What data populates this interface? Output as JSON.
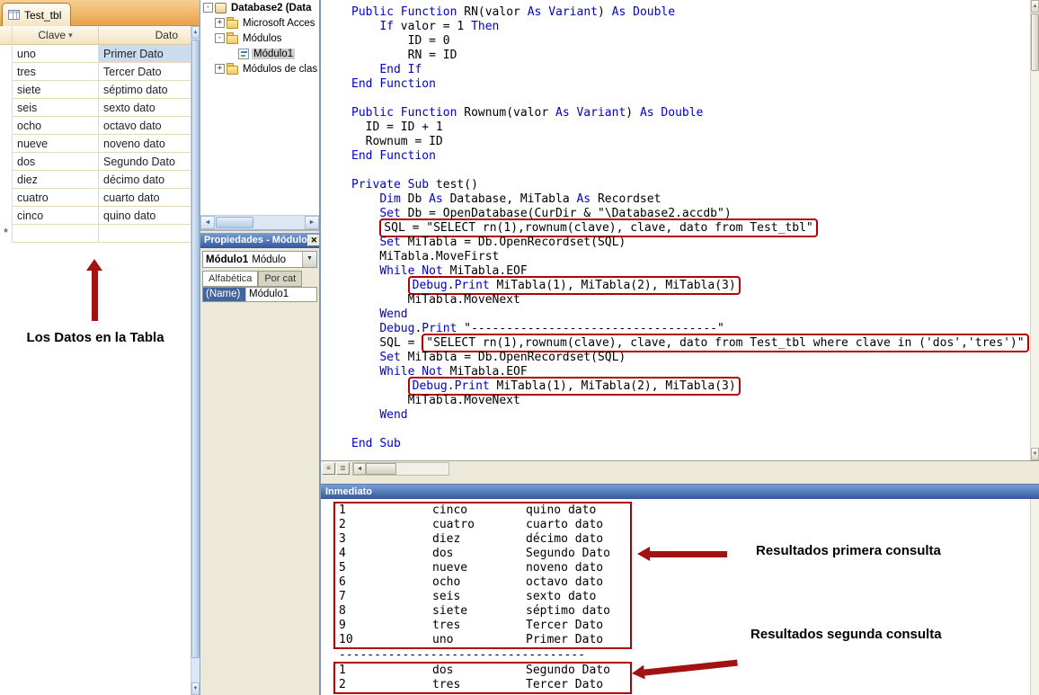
{
  "colors": {
    "annotation_red": "#a31212",
    "highlight_red": "#b40000",
    "keyword_blue": "#0000c8",
    "selection_blue": "#cbdcf0"
  },
  "table_panel": {
    "tab": "Test_tbl",
    "header": {
      "clave": "Clave",
      "dato": "Dato"
    },
    "rows": [
      {
        "clave": "uno",
        "dato": "Primer Dato",
        "selected": true
      },
      {
        "clave": "tres",
        "dato": "Tercer Dato"
      },
      {
        "clave": "siete",
        "dato": "séptimo dato"
      },
      {
        "clave": "seis",
        "dato": "sexto dato"
      },
      {
        "clave": "ocho",
        "dato": "octavo dato"
      },
      {
        "clave": "nueve",
        "dato": "noveno dato"
      },
      {
        "clave": "dos",
        "dato": "Segundo Dato"
      },
      {
        "clave": "diez",
        "dato": "décimo dato"
      },
      {
        "clave": "cuatro",
        "dato": "cuarto dato"
      },
      {
        "clave": "cinco",
        "dato": "quino dato"
      }
    ],
    "new_record_marker": "*",
    "annotation": "Los Datos en la Tabla"
  },
  "vbe": {
    "project_tree": {
      "items": [
        {
          "label": "Database2 (Data",
          "icon": "db",
          "expander": "-",
          "level": 0,
          "bold": true
        },
        {
          "label": "Microsoft Acces",
          "icon": "folder",
          "expander": "+",
          "level": 1
        },
        {
          "label": "Módulos",
          "icon": "folder",
          "expander": "-",
          "level": 1
        },
        {
          "label": "Módulo1",
          "icon": "module",
          "expander": "",
          "level": 2,
          "selected": true
        },
        {
          "label": "Módulos de clas",
          "icon": "folder",
          "expander": "+",
          "level": 1
        }
      ]
    },
    "properties": {
      "title": "Propiedades - Módulo",
      "close_glyph": "✕",
      "selector_name": "Módulo1",
      "selector_type": "Módulo",
      "tabs": [
        {
          "label": "Alfabética"
        },
        {
          "label": "Por cat"
        }
      ],
      "grid": {
        "name": "(Name)",
        "value": "Módulo1"
      }
    }
  },
  "code": {
    "keywords": [
      "Public",
      "Private",
      "Function",
      "Sub",
      "End",
      "If",
      "Then",
      "Dim",
      "Set",
      "As",
      "While",
      "Not",
      "Wend",
      "Debug",
      "Print",
      "Variant",
      "Double"
    ],
    "lines": [
      {
        "text": "Public Function RN(valor As Variant) As Double"
      },
      {
        "text": "    If valor = 1 Then"
      },
      {
        "text": "        ID = 0"
      },
      {
        "text": "        RN = ID"
      },
      {
        "text": "    End If"
      },
      {
        "text": "End Function"
      },
      {
        "text": ""
      },
      {
        "text": "Public Function Rownum(valor As Variant) As Double"
      },
      {
        "text": "  ID = ID + 1"
      },
      {
        "text": "  Rownum = ID"
      },
      {
        "text": "End Function"
      },
      {
        "text": ""
      },
      {
        "text": "Private Sub test()"
      },
      {
        "text": "    Dim Db As Database, MiTabla As Recordset"
      },
      {
        "text": "    Set Db = OpenDatabase(CurDir & \"\\Database2.accdb\")"
      },
      {
        "text": "    SQL = \"SELECT rn(1),rownum(clave), clave, dato from Test_tbl\"",
        "boxFrom": 4
      },
      {
        "text": "    Set MiTabla = Db.OpenRecordset(SQL)"
      },
      {
        "text": "    MiTabla.MoveFirst"
      },
      {
        "text": "    While Not MiTabla.EOF"
      },
      {
        "text": "        Debug.Print MiTabla(1), MiTabla(2), MiTabla(3)",
        "boxFrom": 8
      },
      {
        "text": "        MiTabla.MoveNext"
      },
      {
        "text": "    Wend"
      },
      {
        "text": "    Debug.Print \"-----------------------------------\""
      },
      {
        "text": "    SQL = \"SELECT rn(1),rownum(clave), clave, dato from Test_tbl where clave in ('dos','tres')\"",
        "boxFrom": 10
      },
      {
        "text": "    Set MiTabla = Db.OpenRecordset(SQL)"
      },
      {
        "text": "    While Not MiTabla.EOF"
      },
      {
        "text": "        Debug.Print MiTabla(1), MiTabla(2), MiTabla(3)",
        "boxFrom": 8
      },
      {
        "text": "        MiTabla.MoveNext"
      },
      {
        "text": "    Wend"
      },
      {
        "text": ""
      },
      {
        "text": "End Sub"
      }
    ]
  },
  "immediate": {
    "title": "Inmediato",
    "block1": [
      [
        "1",
        "cinco",
        "quino dato"
      ],
      [
        "2",
        "cuatro",
        "cuarto dato"
      ],
      [
        "3",
        "diez",
        "décimo dato"
      ],
      [
        "4",
        "dos",
        "Segundo Dato"
      ],
      [
        "5",
        "nueve",
        "noveno dato"
      ],
      [
        "6",
        "ocho",
        "octavo dato"
      ],
      [
        "7",
        "seis",
        "sexto dato"
      ],
      [
        "8",
        "siete",
        "séptimo dato"
      ],
      [
        "9",
        "tres",
        "Tercer Dato"
      ],
      [
        "10",
        "uno",
        "Primer Dato"
      ]
    ],
    "separator": "-----------------------------------",
    "block2": [
      [
        "1",
        "dos",
        "Segundo Dato"
      ],
      [
        "2",
        "tres",
        "Tercer Dato"
      ]
    ],
    "annotations": {
      "first": "Resultados primera consulta",
      "second": "Resultados segunda consulta"
    }
  }
}
